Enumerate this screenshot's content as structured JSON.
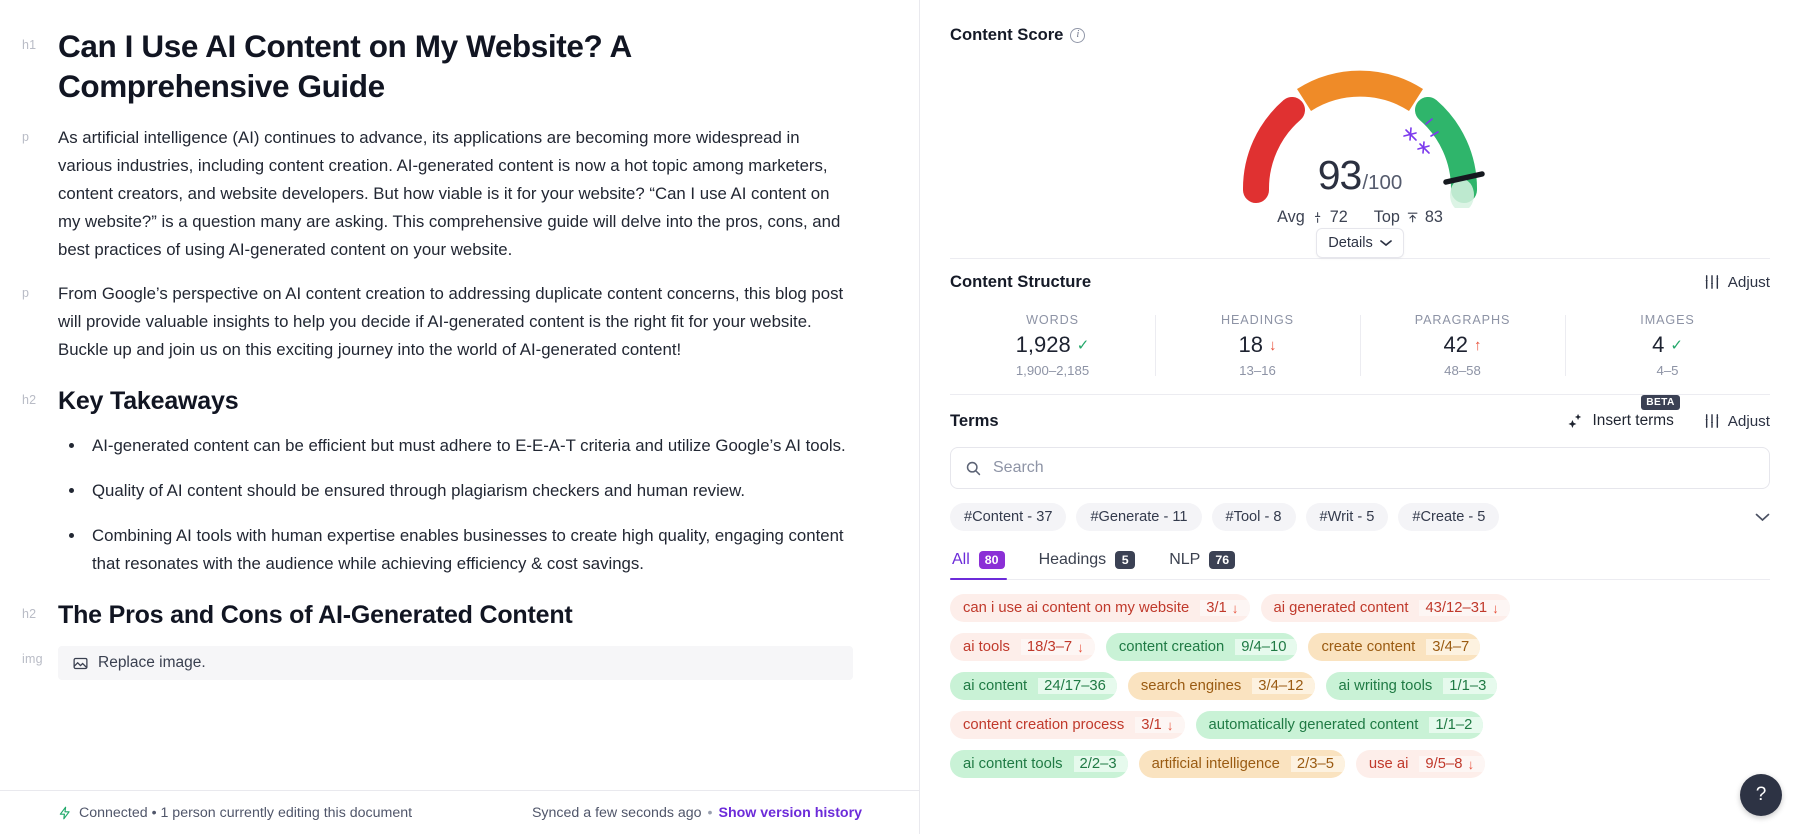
{
  "editor": {
    "h1": "Can I Use AI Content on My Website? A Comprehensive Guide",
    "gutter_h1": "h1",
    "gutter_p": "p",
    "gutter_h2": "h2",
    "gutter_img": "img",
    "p1": "As artificial intelligence (AI) continues to advance, its applications are becoming more widespread in various industries, including content creation. AI-generated content is now a hot topic among marketers, content creators, and website developers. But how viable is it for your website? “Can I use AI content on my website?” is a question many are asking. This comprehensive guide will delve into the pros, cons, and best practices of using AI-generated content on your website.",
    "p2": "From Google’s perspective on AI content creation to addressing duplicate content concerns, this blog post will provide valuable insights to help you decide if AI-generated content is the right fit for your website. Buckle up and join us on this exciting journey into the world of AI-generated content!",
    "h2_a": "Key Takeaways",
    "bullets": [
      "AI-generated content can be efficient but must adhere to E-E-A-T criteria and utilize Google’s AI tools.",
      "Quality of AI content should be ensured through plagiarism checkers and human review.",
      "Combining AI tools with human expertise enables businesses to create high quality, engaging content that resonates with the audience while achieving efficiency & cost savings."
    ],
    "h2_b": "The Pros and Cons of AI-Generated Content",
    "image_placeholder": "Replace image."
  },
  "statusbar": {
    "connection": "Connected • 1 person currently editing this document",
    "synced": "Synced a few seconds ago",
    "separator": "•",
    "version_link": "Show version history"
  },
  "content_score": {
    "title": "Content Score",
    "score": "93",
    "denominator": "/100",
    "avg_label": "Avg",
    "avg_value": "72",
    "top_label": "Top",
    "top_value": "83",
    "details_label": "Details"
  },
  "content_structure": {
    "title": "Content Structure",
    "adjust_label": "Adjust",
    "stats": [
      {
        "label": "WORDS",
        "value": "1,928",
        "marker": "check",
        "range": "1,900–2,185"
      },
      {
        "label": "HEADINGS",
        "value": "18",
        "marker": "down",
        "range": "13–16"
      },
      {
        "label": "PARAGRAPHS",
        "value": "42",
        "marker": "up",
        "range": "48–58"
      },
      {
        "label": "IMAGES",
        "value": "4",
        "marker": "check",
        "range": "4–5"
      }
    ]
  },
  "terms": {
    "title": "Terms",
    "insert_terms_label": "Insert terms",
    "beta_label": "BETA",
    "adjust_label": "Adjust",
    "search_placeholder": "Search",
    "search_value": "",
    "chips": [
      "#Content - 37",
      "#Generate - 11",
      "#Tool - 8",
      "#Writ - 5",
      "#Create - 5"
    ],
    "tabs": [
      {
        "label": "All",
        "badge": "80",
        "active": true
      },
      {
        "label": "Headings",
        "badge": "5",
        "active": false
      },
      {
        "label": "NLP",
        "badge": "76",
        "active": false
      }
    ],
    "rows": [
      [
        {
          "name": "can i use ai content on my website",
          "count": "3/1",
          "state": "red",
          "arrow": "down"
        },
        {
          "name": "ai generated content",
          "count": "43/12–31",
          "state": "red",
          "arrow": "down"
        }
      ],
      [
        {
          "name": "ai tools",
          "count": "18/3–7",
          "state": "red",
          "arrow": "down"
        },
        {
          "name": "content creation",
          "count": "9/4–10",
          "state": "green",
          "arrow": ""
        },
        {
          "name": "create content",
          "count": "3/4–7",
          "state": "orange",
          "arrow": ""
        }
      ],
      [
        {
          "name": "ai content",
          "count": "24/17–36",
          "state": "green",
          "arrow": ""
        },
        {
          "name": "search engines",
          "count": "3/4–12",
          "state": "orange",
          "arrow": ""
        },
        {
          "name": "ai writing tools",
          "count": "1/1–3",
          "state": "green",
          "arrow": ""
        }
      ],
      [
        {
          "name": "content creation process",
          "count": "3/1",
          "state": "red",
          "arrow": "down"
        },
        {
          "name": "automatically generated content",
          "count": "1/1–2",
          "state": "green",
          "arrow": ""
        }
      ],
      [
        {
          "name": "ai content tools",
          "count": "2/2–3",
          "state": "green",
          "arrow": ""
        },
        {
          "name": "artificial intelligence",
          "count": "2/3–5",
          "state": "orange",
          "arrow": ""
        },
        {
          "name": "use ai",
          "count": "9/5–8",
          "state": "red",
          "arrow": "down"
        }
      ]
    ]
  },
  "help": {
    "label": "?"
  },
  "colors": {
    "accent": "#6c2bd9",
    "gauge_red": "#e03131",
    "gauge_orange": "#ef8b28",
    "gauge_green": "#2fb56b",
    "ok": "#23a76a",
    "warn": "#e8503a"
  }
}
